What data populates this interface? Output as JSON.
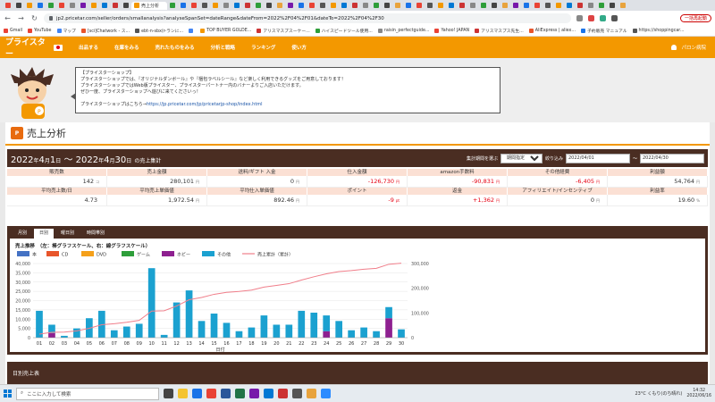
{
  "browser": {
    "active_tab_title": "売上分析",
    "url": "jp2.pricetar.com/seller/orders/smallanalysis?analyseSpanSet=dateRange&dateFrom=2022%2F04%2F01&dateTo=2022%2F04%2F30",
    "update_label": "一括再起動",
    "bookmarks": [
      "Gmail",
      "YouTube",
      "マップ",
      "[sci]Chatwork - ス...",
      "ebt-n-sbx(r-ランに...",
      "",
      "TOP BUYER GOLDE...",
      "アリスマスプスーケー...",
      "ハイスピードツール使用...",
      "raisin_perfectguide...",
      "Yahoo! JAPAN",
      "アリスマスプス先生...",
      "AliExpress | aliex...",
      "子約販売 マニュアル",
      "https://shoppingcar..."
    ]
  },
  "site": {
    "logo": "プライスター",
    "nav": [
      "出品する",
      "在庫をみる",
      "売れたものをみる",
      "分析と戦略",
      "ランキング",
      "使い方"
    ],
    "user": "パロン病院"
  },
  "notice": {
    "heading": "【プライスターショップ】",
    "line1": "プライスターショップでは、『オリジナルダンボール』や『梱包ラベルシール』など楽しく利用できるグッズをご用意しております！",
    "line2": "プライスターショップではWeb版プライスター、プライスターパートナー内のバナーよりご入店いただけます。",
    "line3": "ぜひ一度、プライスターショップへ遊びに来てくださいっ！",
    "link_prefix": "プライスターショップはこちら→",
    "link": "https://jp.pricetar.com/jp/pricetarjp-shop/index.html"
  },
  "page": {
    "badge": "P",
    "title": "売上分析",
    "period_y1": "2022",
    "period_m1": "4",
    "period_d1": "1",
    "period_y2": "2022",
    "period_m2": "4",
    "period_d2": "30",
    "u_year": "年",
    "u_month": "月",
    "u_day": "日",
    "sep": "〜",
    "period_suffix": "の売上集計",
    "filter_label": "集計期間を選ぶ",
    "filter_value": "期間指定",
    "filter_button": "絞り込み",
    "date_from": "2022/04/01",
    "date_sep": "〜",
    "date_to": "2022/04/30"
  },
  "stats": {
    "row1_headers": [
      "販売数",
      "売上金額",
      "送料/ギフト 入金",
      "仕入金額",
      "amazon手数料",
      "その他経費",
      "利益額"
    ],
    "row1_values": [
      {
        "v": "142",
        "u": "コ",
        "neg": false
      },
      {
        "v": "280,101",
        "u": "円",
        "neg": false
      },
      {
        "v": "0",
        "u": "円",
        "neg": false
      },
      {
        "v": "-126,730",
        "u": "円",
        "neg": true
      },
      {
        "v": "-90,831",
        "u": "円",
        "neg": true
      },
      {
        "v": "-6,405",
        "u": "円",
        "neg": true
      },
      {
        "v": "54,764",
        "u": "円",
        "neg": false
      }
    ],
    "row2_headers": [
      "平均売上数/日",
      "平均売上単価値",
      "平均仕入単価値",
      "ポイント",
      "返金",
      "アフィリエイト/インセンティブ",
      "利益率"
    ],
    "row2_values": [
      {
        "v": "4.73",
        "u": "",
        "neg": false
      },
      {
        "v": "1,972.54",
        "u": "円",
        "neg": false
      },
      {
        "v": "892.46",
        "u": "円",
        "neg": false
      },
      {
        "v": "-9",
        "u": "pt",
        "neg": true
      },
      {
        "v": "+1,362",
        "u": "円",
        "neg": true
      },
      {
        "v": "0",
        "u": "円",
        "neg": false
      },
      {
        "v": "19.60",
        "u": "%",
        "neg": false
      }
    ]
  },
  "tabs": [
    "月別",
    "日別",
    "曜日別",
    "時間帯別"
  ],
  "daily_heading": "日別売上表",
  "chart_data": {
    "type": "bar",
    "title": "売上推移　（左：棒グラフスケール、右：線グラフスケール）",
    "xlabel": "日付",
    "categories": [
      "01",
      "02",
      "03",
      "04",
      "05",
      "06",
      "07",
      "08",
      "09",
      "10",
      "11",
      "12",
      "13",
      "14",
      "15",
      "16",
      "17",
      "18",
      "19",
      "20",
      "21",
      "22",
      "23",
      "24",
      "25",
      "26",
      "27",
      "28",
      "29",
      "30"
    ],
    "ylim": [
      0,
      40000
    ],
    "yticks": [
      "0",
      "5,000",
      "10,000",
      "15,000",
      "20,000",
      "25,000",
      "30,000",
      "35,000",
      "40,000"
    ],
    "y2lim": [
      0,
      300000
    ],
    "y2ticks": [
      "0",
      "100,000",
      "200,000",
      "300,000"
    ],
    "legend": [
      "本",
      "CD",
      "DVD",
      "ゲーム",
      "ホビー",
      "その他",
      "売上累計（累計）"
    ],
    "colors": {
      "本": "#4472c4",
      "CD": "#e8552b",
      "DVD": "#f5a01a",
      "ゲーム": "#2e9e3a",
      "ホビー": "#8e2090",
      "その他": "#1ba1d0",
      "cumulative": "#f07e8a"
    },
    "series": [
      {
        "name": "その他",
        "values": [
          14500,
          4500,
          1000,
          5000,
          10500,
          14500,
          4000,
          6000,
          7500,
          37500,
          1500,
          19000,
          25500,
          9000,
          13000,
          8000,
          3500,
          5500,
          12000,
          7000,
          7000,
          14500,
          13500,
          8500,
          9000,
          4000,
          5500,
          3500,
          6000,
          4500
        ]
      },
      {
        "name": "ホビー",
        "values": [
          0,
          2500,
          0,
          0,
          0,
          0,
          0,
          0,
          0,
          0,
          0,
          0,
          0,
          0,
          0,
          0,
          0,
          0,
          0,
          0,
          0,
          0,
          0,
          3500,
          0,
          0,
          0,
          0,
          10500,
          0
        ]
      }
    ],
    "cumulative": [
      14500,
      21500,
      22500,
      27500,
      38000,
      52500,
      56500,
      62500,
      70000,
      107500,
      109000,
      128000,
      153500,
      162500,
      175500,
      183500,
      187000,
      192500,
      204500,
      211500,
      218500,
      233000,
      246500,
      258500,
      267500,
      271500,
      277000,
      280500,
      297000,
      301500
    ]
  },
  "taskbar": {
    "search_placeholder": "ここに入力して検索",
    "weather": "23°C くもり(のち晴れ)",
    "time": "14:32",
    "date": "2022/06/16"
  }
}
